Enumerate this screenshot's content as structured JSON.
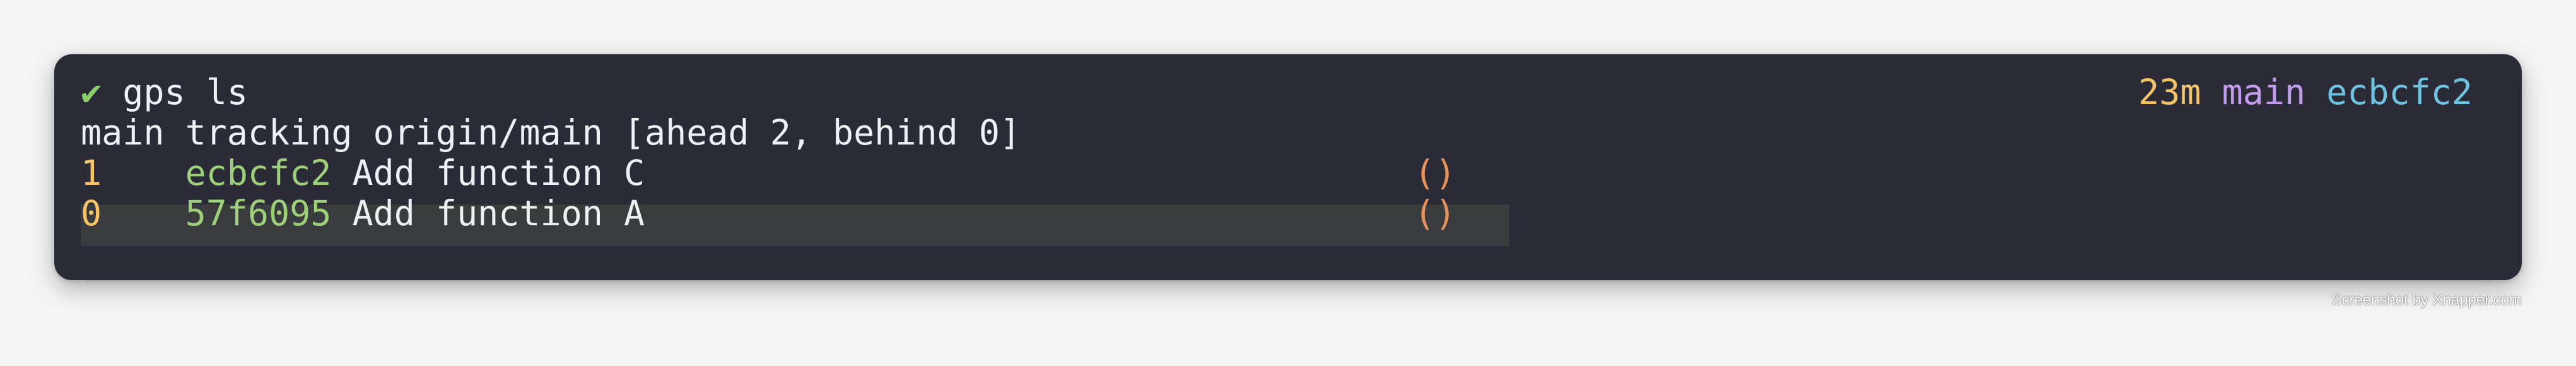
{
  "terminal": {
    "prompt_symbol": "✔",
    "command": "gps ls",
    "status": {
      "time": "23m",
      "branch": "main",
      "sha": "ecbcfc2"
    },
    "tracking_line": "main tracking origin/main [ahead 2, behind 0]",
    "commits": [
      {
        "index": "1",
        "sha": "ecbcfc2",
        "message": "Add function C",
        "marker": "()"
      },
      {
        "index": "0",
        "sha": "57f6095",
        "message": "Add function A",
        "marker": "()"
      }
    ]
  },
  "credit": "Screenshot by Xnapper.com",
  "colors": {
    "background": "#2a2b37",
    "check": "#8ccf6a",
    "index": "#f4c46a",
    "sha": "#9ed07a",
    "marker": "#e8915a",
    "branch": "#c39cf0",
    "head_sha": "#6fc3e0"
  }
}
